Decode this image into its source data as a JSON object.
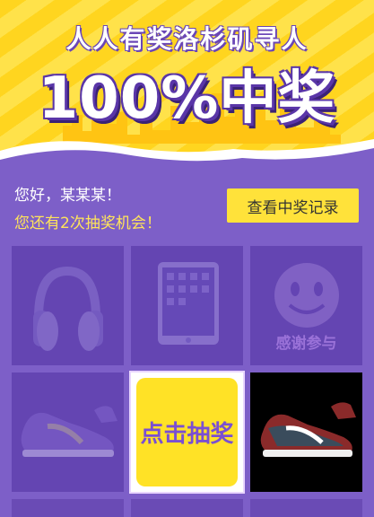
{
  "banner": {
    "subtitle": "人人有奖洛杉矶寻人",
    "title": "100%中奖"
  },
  "user": {
    "greeting": "您好，某某某！",
    "chances_text": "您还有2次抽奖机会！"
  },
  "record_button_label": "查看中奖记录",
  "prizes": [
    {
      "name": "headphones-icon"
    },
    {
      "name": "tablet-icon"
    },
    {
      "name": "smiley-icon",
      "label": "感谢参与"
    },
    {
      "name": "sneaker-icon"
    },
    {
      "draw_label": "点击抽奖"
    },
    {
      "name": "sneaker-icon"
    }
  ],
  "colors": {
    "background": "#7d5fc8",
    "banner_yellow": "#ffd51f",
    "button_yellow": "#ffe23a",
    "chances_text": "#ffe45a"
  }
}
